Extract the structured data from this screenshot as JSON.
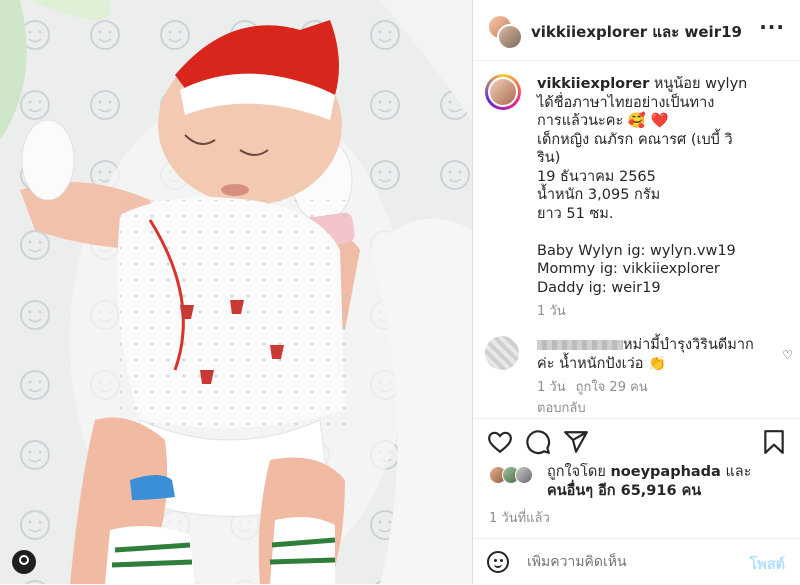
{
  "header": {
    "title": "vikkiiexplorer และ weir19",
    "more_label": "···"
  },
  "caption": {
    "username": "vikkiiexplorer",
    "lines": [
      " หนูน้อย wylyn",
      "ได้ชื่อภาษาไทยอย่างเป็นทาง",
      "การแล้วนะคะ 🥰 ❤️",
      "เด็กหญิง ณภัรก คณารศ (เบบี้ วิ",
      "ริน)",
      "19 ธันวาคม 2565",
      "น้ำหนัก 3,095 กรัม",
      "ยาว 51 ซม.",
      "",
      "Baby Wylyn ig: wylyn.vw19",
      "Mommy ig: vikkiiexplorer",
      "Daddy ig: weir19"
    ],
    "time": "1 วัน"
  },
  "comment": {
    "text": "หม่ามี้บำรุงวิรินดีมากค่ะ น้ำหนักปังเว่อ 👏",
    "time": "1 วัน",
    "likes": "ถูกใจ 29 คน",
    "reply": "ตอบกลับ"
  },
  "likes": {
    "prefix": "ถูกใจโดย ",
    "user": "noeypaphada",
    "middle": " และ",
    "others": "คนอื่นๆ อีก 65,916 คน"
  },
  "post_age": "1 วันที่แล้ว",
  "add_comment": {
    "placeholder": "เพิ่มความคิดเห็น",
    "post_label": "โพสต์"
  },
  "icons": {
    "like": "heart-icon",
    "comment": "comment-icon",
    "share": "share-icon",
    "save": "bookmark-icon",
    "emoji": "emoji-icon"
  }
}
